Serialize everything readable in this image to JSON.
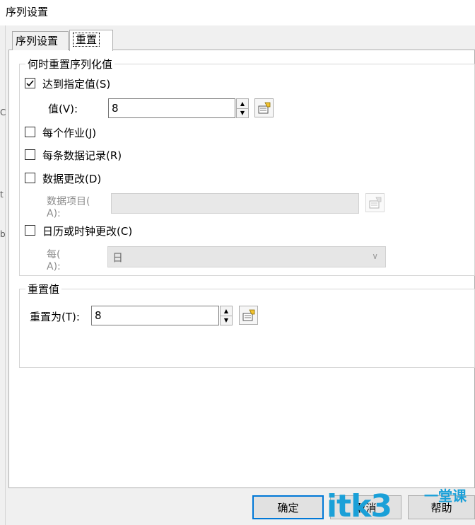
{
  "window": {
    "title": "序列设置"
  },
  "tabs": [
    {
      "label": "序列设置"
    },
    {
      "label": "重置"
    }
  ],
  "when_group": {
    "legend": "何时重置序列化值",
    "reach_value": {
      "label": "达到指定值(S)",
      "checked": true
    },
    "value_field": {
      "label": "值(V):",
      "value": "8"
    },
    "each_job": {
      "label": "每个作业(J)",
      "checked": false
    },
    "each_record": {
      "label": "每条数据记录(R)",
      "checked": false
    },
    "data_change": {
      "label": "数据更改(D)",
      "checked": false
    },
    "data_item": {
      "label_line1": "数据项目(",
      "label_line2": "A):",
      "value": ""
    },
    "calendar_change": {
      "label": "日历或时钟更改(C)",
      "checked": false
    },
    "every": {
      "label_line1": "每(",
      "label_line2": "A):",
      "selected": "日"
    }
  },
  "reset_group": {
    "legend": "重置值",
    "reset_to": {
      "label": "重置为(T):",
      "value": "8"
    }
  },
  "buttons": {
    "ok": "确定",
    "cancel": "取消",
    "help": "帮助"
  },
  "left_marks": [
    "C",
    "t",
    "b"
  ],
  "watermark": {
    "main": "itk3",
    "sub_line1": "一堂课",
    "sub_line2": ""
  },
  "colors": {
    "accent": "#0078d7",
    "watermark": "#1aa0d8"
  }
}
